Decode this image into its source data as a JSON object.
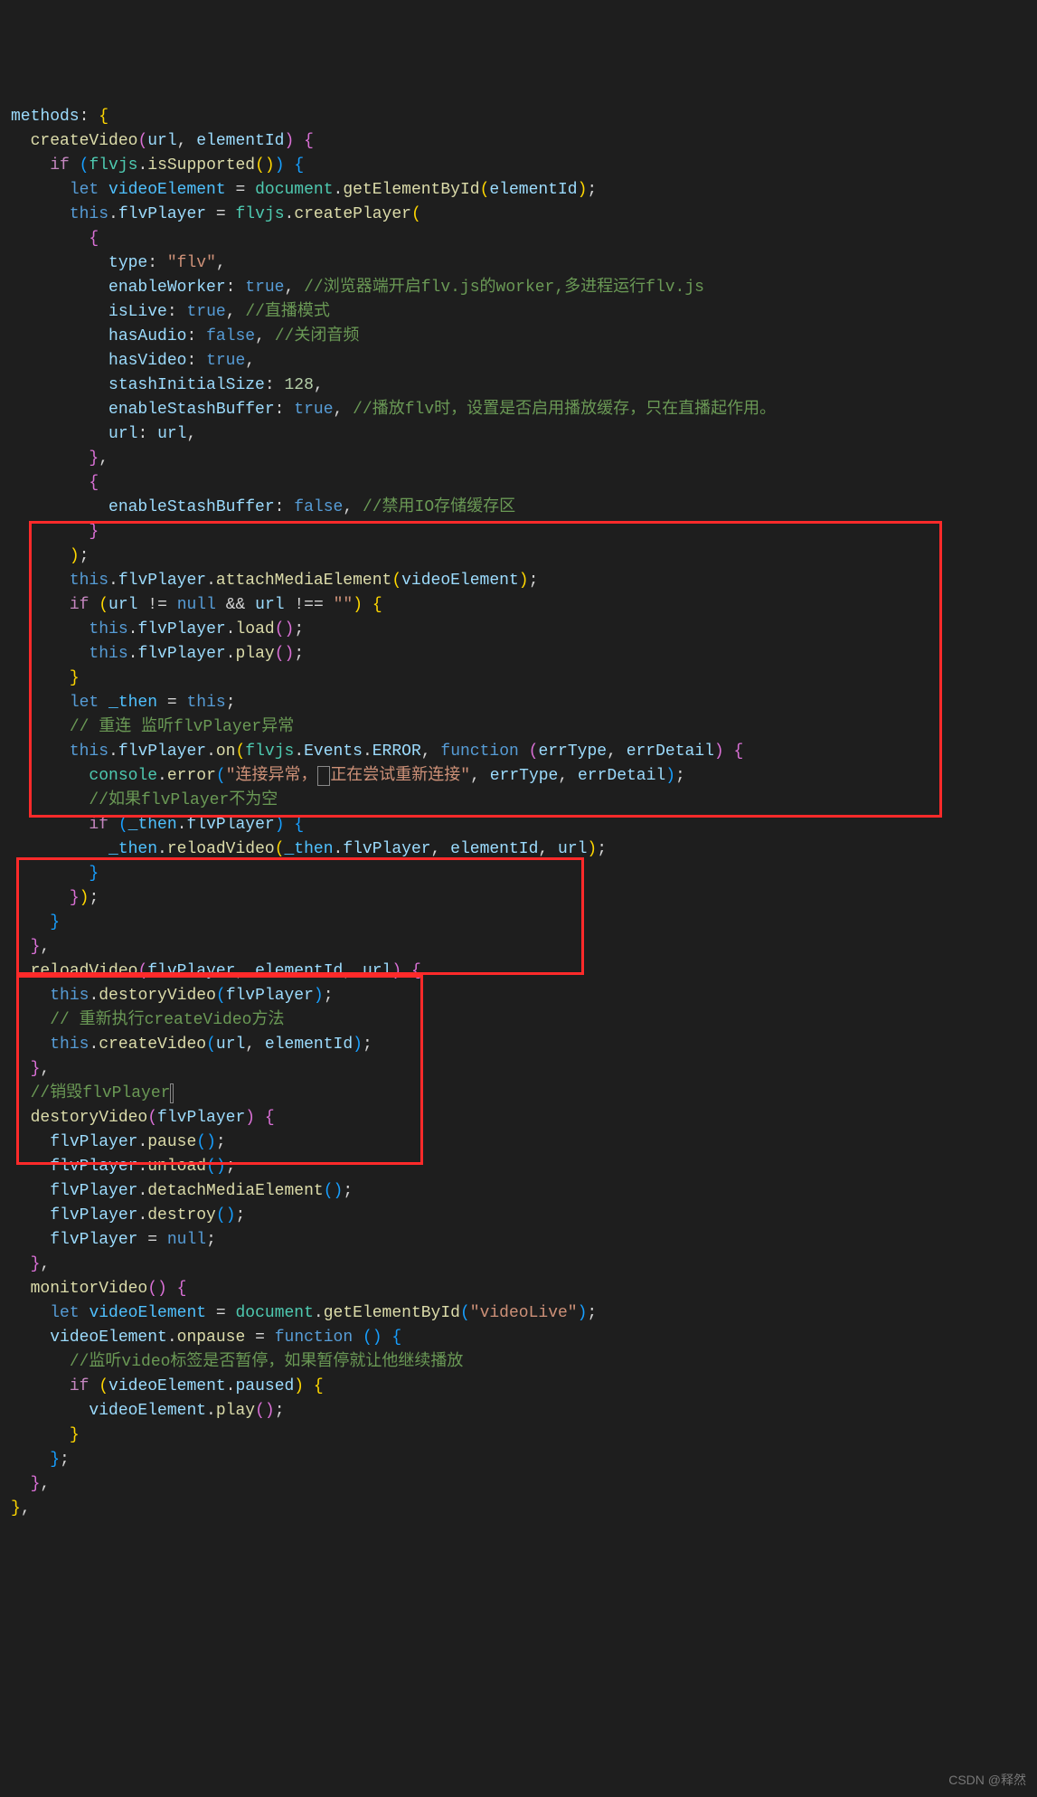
{
  "code": {
    "l01a": "methods",
    "l01b": ":",
    "l02a": "createVideo",
    "l02p1": "url",
    "l02p2": "elementId",
    "l03_if": "if",
    "l03_flv": "flvjs",
    "l03_is": "isSupported",
    "l04_let": "let",
    "l04_v": "videoElement",
    "l04_doc": "document",
    "l04_g": "getElementById",
    "l04_el": "elementId",
    "l05_this": "this",
    "l05_fp": "flvPlayer",
    "l05_flv": "flvjs",
    "l05_cp": "createPlayer",
    "l07_type": "type",
    "l07_flv": "\"flv\"",
    "l08_ew": "enableWorker",
    "l08_true": "true",
    "l08_c": "//浏览器端开启flv.js的worker,多进程运行flv.js",
    "l09_il": "isLive",
    "l09_true": "true",
    "l09_c": "//直播模式",
    "l10_ha": "hasAudio",
    "l10_false": "false",
    "l10_c": "//关闭音频",
    "l11_hv": "hasVideo",
    "l11_true": "true",
    "l12_sis": "stashInitialSize",
    "l12_n": "128",
    "l13_esb": "enableStashBuffer",
    "l13_true": "true",
    "l13_c": "//播放flv时，设置是否启用播放缓存，只在直播起作用。",
    "l14_url": "url",
    "l14_urlv": "url",
    "l17_esb": "enableStashBuffer",
    "l17_false": "false",
    "l17_c": "//禁用IO存储缓存区",
    "l20_this": "this",
    "l20_fp": "flvPlayer",
    "l20_ame": "attachMediaElement",
    "l20_ve": "videoElement",
    "l21_if": "if",
    "l21_url": "url",
    "l21_null": "null",
    "l21_url2": "url",
    "l21_s": "\"\"",
    "l22_this": "this",
    "l22_fp": "flvPlayer",
    "l22_load": "load",
    "l23_this": "this",
    "l23_fp": "flvPlayer",
    "l23_play": "play",
    "l25_let": "let",
    "l25_then": "_then",
    "l25_this": "this",
    "l26_c": "// 重连 监听flvPlayer异常",
    "l27_this": "this",
    "l27_fp": "flvPlayer",
    "l27_on": "on",
    "l27_flv": "flvjs",
    "l27_ev": "Events",
    "l27_err": "ERROR",
    "l27_fun": "function",
    "l27_p1": "errType",
    "l27_p2": "errDetail",
    "l28_con": "console",
    "l28_er": "error",
    "l28_s": "\"连接异常，",
    "l28_s2": "正在尝试重新连接\"",
    "l28_p1": "errType",
    "l28_p2": "errDetail",
    "l29_c": "//如果flvPlayer不为空",
    "l30_if": "if",
    "l30_then": "_then",
    "l30_fp": "flvPlayer",
    "l31_then": "_then",
    "l31_rv": "reloadVideo",
    "l31_then2": "_then",
    "l31_fp": "flvPlayer",
    "l31_el": "elementId",
    "l31_url": "url",
    "rv_name": "reloadVideo",
    "rv_p1": "flvPlayer",
    "rv_p2": "elementId",
    "rv_p3": "url",
    "rv_l1_this": "this",
    "rv_l1_dv": "destoryVideo",
    "rv_l1_fp": "flvPlayer",
    "rv_l2_c": "// 重新执行createVideo方法",
    "rv_l3_this": "this",
    "rv_l3_cv": "createVideo",
    "rv_l3_url": "url",
    "rv_l3_el": "elementId",
    "dv_c": "//销毁flvPlayer",
    "dv_cur": "|",
    "dv_name": "destoryVideo",
    "dv_p1": "flvPlayer",
    "dv_l1": "flvPlayer",
    "dv_l1f": "pause",
    "dv_l2": "flvPlayer",
    "dv_l2f": "unload",
    "dv_l3": "flvPlayer",
    "dv_l3f": "detachMediaElement",
    "dv_l4": "flvPlayer",
    "dv_l4f": "destroy",
    "dv_l5": "flvPlayer",
    "dv_l5n": "null",
    "mv_name": "monitorVideo",
    "mv_let": "let",
    "mv_ve": "videoElement",
    "mv_doc": "document",
    "mv_g": "getElementById",
    "mv_s": "\"videoLive\"",
    "mv_ve2": "videoElement",
    "mv_onp": "onpause",
    "mv_fun": "function",
    "mv_c": "//监听video标签是否暂停，如果暂停就让他继续播放",
    "mv_if": "if",
    "mv_ve3": "videoElement",
    "mv_p": "paused",
    "mv_ve4": "videoElement",
    "mv_play": "play"
  },
  "watermark": "CSDN @释然"
}
